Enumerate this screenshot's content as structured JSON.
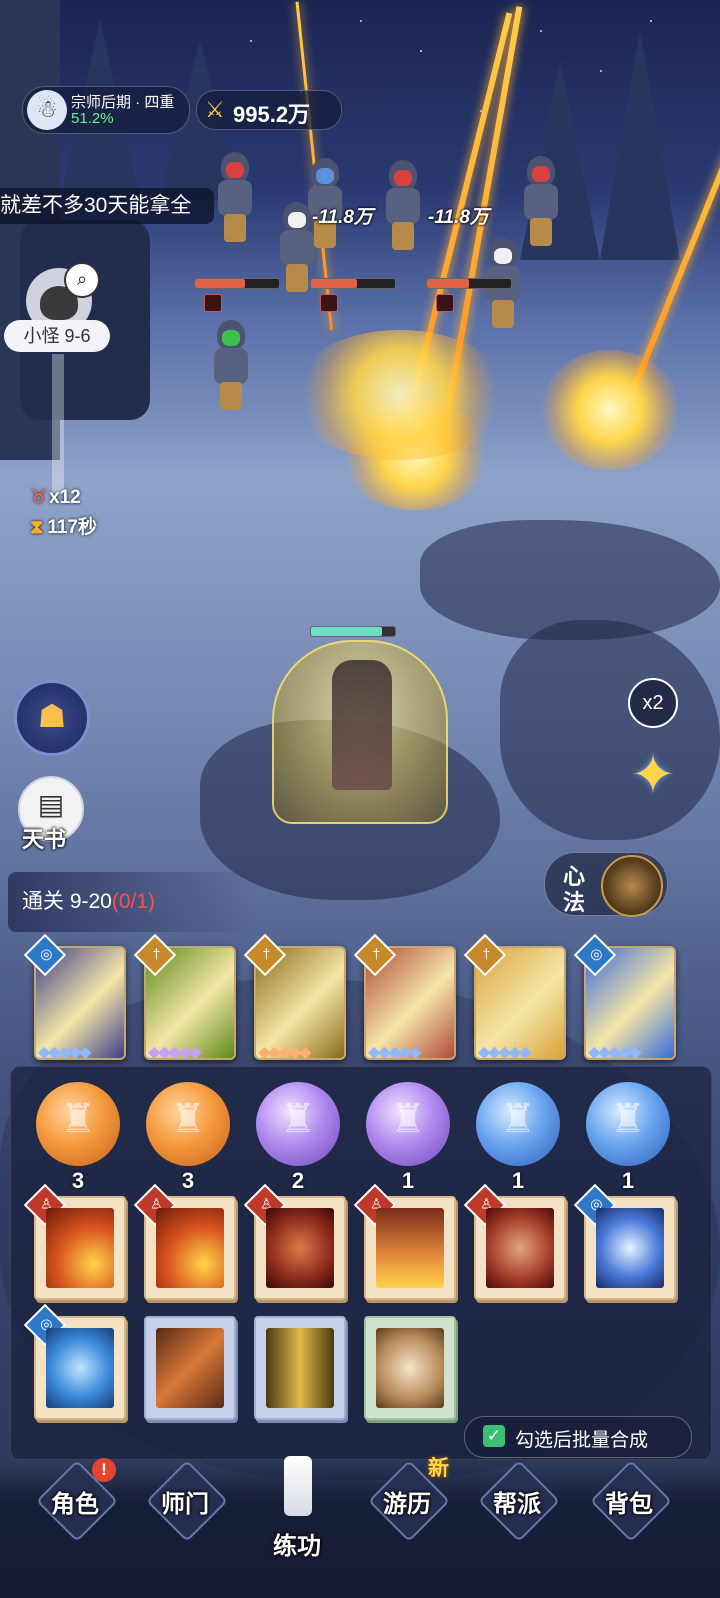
{
  "header": {
    "rank_label": "宗师后期 · 四重",
    "rank_progress": "51.2%",
    "power_value": "995.2万",
    "chat_text": "就差不多30天能拿全"
  },
  "battle": {
    "damage_numbers": [
      "-11.8万",
      "-11.8万"
    ],
    "enemy_hp_fractions": [
      0.6,
      0.55,
      0.5
    ],
    "player_hp_fraction": 0.85
  },
  "stage": {
    "label": "小怪 9-6",
    "kill_count": "x12",
    "time_left": "117秒"
  },
  "side_buttons": {
    "book_label": "天书",
    "speed_label": "x2",
    "xinfa_label_1": "心",
    "xinfa_label_2": "法"
  },
  "quest": {
    "label": "通关 9-20",
    "progress": "(0/1)"
  },
  "skill_cards": [
    {
      "element": "water",
      "tag_icon": "swirl-icon",
      "gem_color": "#8fb8ff",
      "art": "#3b3f8a"
    },
    {
      "element": "sword",
      "tag_icon": "sword-icon",
      "gem_color": "#c7a0ff",
      "art": "#5d8a1a"
    },
    {
      "element": "sword",
      "tag_icon": "sword-icon",
      "gem_color": "#ffb070",
      "art": "#8a6a1a"
    },
    {
      "element": "sword",
      "tag_icon": "sword-icon",
      "gem_color": "#8fb8ff",
      "art": "#b04a3a"
    },
    {
      "element": "sword",
      "tag_icon": "sword-icon",
      "gem_color": "#8fb8ff",
      "art": "#d9a23a"
    },
    {
      "element": "water",
      "tag_icon": "swirl-icon",
      "gem_color": "#8fb8ff",
      "art": "#3a6ad9"
    }
  ],
  "orbs": [
    {
      "color": "orange",
      "count": "3"
    },
    {
      "color": "orange",
      "count": "3"
    },
    {
      "color": "purple",
      "count": "2"
    },
    {
      "color": "purple",
      "count": "1"
    },
    {
      "color": "blue",
      "count": "1"
    },
    {
      "color": "blue",
      "count": "1"
    }
  ],
  "inventory": {
    "batch_label": "勾选后批量合成"
  },
  "nav": {
    "items": [
      "角色",
      "师门",
      "练功",
      "游历",
      "帮派",
      "背包"
    ],
    "active": "练功",
    "alert_badge": "!",
    "new_badge": "新"
  },
  "colors": {
    "accent_gold": "#ffcf4d",
    "progress_green": "#6ef08a",
    "quest_red": "#ff4d4d",
    "check_green": "#3dbf73"
  }
}
